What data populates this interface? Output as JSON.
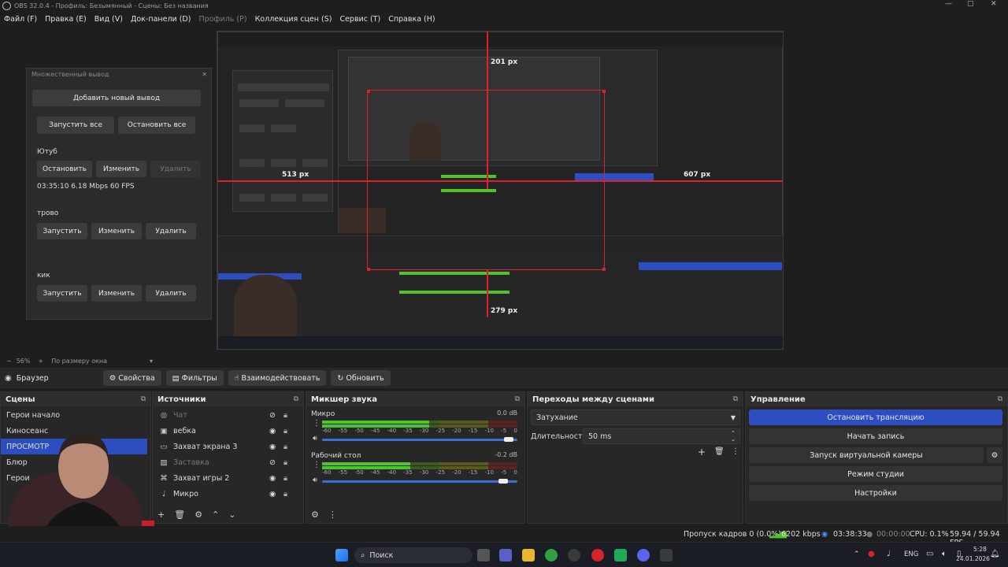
{
  "window": {
    "title": "OBS 32.0.4 - Профиль: Безымянный - Сцены: Без названия",
    "minimize": "—",
    "maximize": "▢",
    "close": "✕"
  },
  "menu": [
    "Файл (F)",
    "Правка (E)",
    "Вид (V)",
    "Док-панели (D)",
    "Профиль (P)",
    "Коллекция сцен (S)",
    "Сервис (T)",
    "Справка (H)"
  ],
  "preview": {
    "measure_labels": [
      "201 px",
      "513 px",
      "607 px",
      "279 px"
    ]
  },
  "multi_output": {
    "title": "Множественный вывод",
    "add_button": "Добавить новый вывод",
    "start_all": "Запустить все",
    "stop_all": "Остановить все",
    "outputs": [
      {
        "name": "Ютуб",
        "buttons": [
          "Остановить",
          "Изменить",
          "Удалить"
        ],
        "status": "03:35:10 6.18 Mbps 60 FPS"
      },
      {
        "name": "трово",
        "buttons": [
          "Запустить",
          "Изменить",
          "Удалить"
        ],
        "status": ""
      },
      {
        "name": "кик",
        "buttons": [
          "Запустить",
          "Изменить",
          "Удалить"
        ],
        "status": ""
      }
    ]
  },
  "zoom": {
    "minus": "−",
    "level": "56%",
    "plus": "+",
    "mode": "По размеру окна",
    "arrow": "▾"
  },
  "source_toolbar": {
    "source_name": "Браузер",
    "properties": "Свойства",
    "filters": "Фильтры",
    "interact": "Взаимодействовать",
    "refresh": "Обновить"
  },
  "scenes": {
    "title": "Сцены",
    "items": [
      "Герои начало",
      "Киносеанс",
      "ПРОСМОТР",
      "Блюр",
      "Герои"
    ],
    "selected_index": 2
  },
  "sources": {
    "title": "Источники",
    "items": [
      {
        "name": "Чат",
        "visible": false,
        "icon": "browser-icon"
      },
      {
        "name": "вебка",
        "visible": true,
        "icon": "camera-icon"
      },
      {
        "name": "Захват экрана 3",
        "visible": true,
        "icon": "monitor-icon"
      },
      {
        "name": "Заставка",
        "visible": false,
        "icon": "image-icon"
      },
      {
        "name": "Захват игры 2",
        "visible": true,
        "icon": "gamepad-icon"
      },
      {
        "name": "Микро",
        "visible": true,
        "icon": "mic-icon"
      }
    ]
  },
  "mixer": {
    "title": "Микшер звука",
    "channels": [
      {
        "name": "Микро",
        "db": "0.0 dB",
        "level": 0.55,
        "volume": 0.98
      },
      {
        "name": "Рабочий стол",
        "db": "-0.2 dB",
        "level": 0.45,
        "volume": 0.95
      }
    ],
    "scale": [
      "-60",
      "-55",
      "-50",
      "-45",
      "-40",
      "-35",
      "-30",
      "-25",
      "-20",
      "-15",
      "-10",
      "-5",
      "0"
    ]
  },
  "transitions": {
    "title": "Переходы между сценами",
    "selected": "Затухание",
    "duration_label": "Длительность",
    "duration_value": "50 ms"
  },
  "controls": {
    "title": "Управление",
    "stop_stream": "Остановить трансляцию",
    "start_record": "Начать запись",
    "virtual_cam": "Запуск виртуальной камеры",
    "studio_mode": "Режим студии",
    "settings": "Настройки"
  },
  "status": {
    "dropped": "Пропуск кадров 0 (0.0%)",
    "bitrate": "6202 kbps",
    "stream_time": "03:38:33",
    "record_time": "00:00:00",
    "cpu": "CPU: 0.1%",
    "fps": "59.94 / 59.94 FPS"
  },
  "taskbar": {
    "search": "Поиск",
    "lang": "ENG",
    "time": "5:28",
    "date": "24.01.2026"
  },
  "colors": {
    "accent": "#2c4ec1",
    "guide": "#e0202c",
    "meter_green": "#4fc42a"
  }
}
